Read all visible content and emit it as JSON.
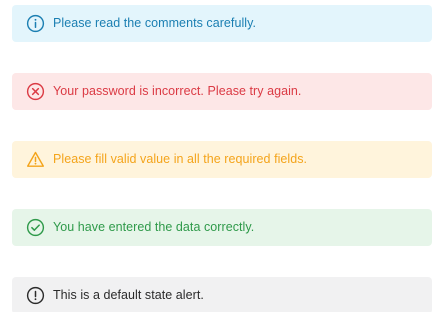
{
  "alerts": [
    {
      "variant": "info",
      "icon": "info-circle-icon",
      "message": "Please read the comments carefully.",
      "color": "#1b7fb2",
      "background": "#e3f5fc"
    },
    {
      "variant": "error",
      "icon": "x-circle-icon",
      "message": "Your password is incorrect. Please try again.",
      "color": "#db3a44",
      "background": "#fde7e7"
    },
    {
      "variant": "warning",
      "icon": "warning-triangle-icon",
      "message": "Please fill valid value in all the required fields.",
      "color": "#f4a41b",
      "background": "#fff4dc"
    },
    {
      "variant": "success",
      "icon": "check-circle-icon",
      "message": "You have entered the data correctly.",
      "color": "#2f9a4a",
      "background": "#e6f5e9"
    },
    {
      "variant": "default",
      "icon": "exclamation-circle-icon",
      "message": "This is a default state alert.",
      "color": "#2b2b2b",
      "background": "#f1f1f2"
    }
  ]
}
